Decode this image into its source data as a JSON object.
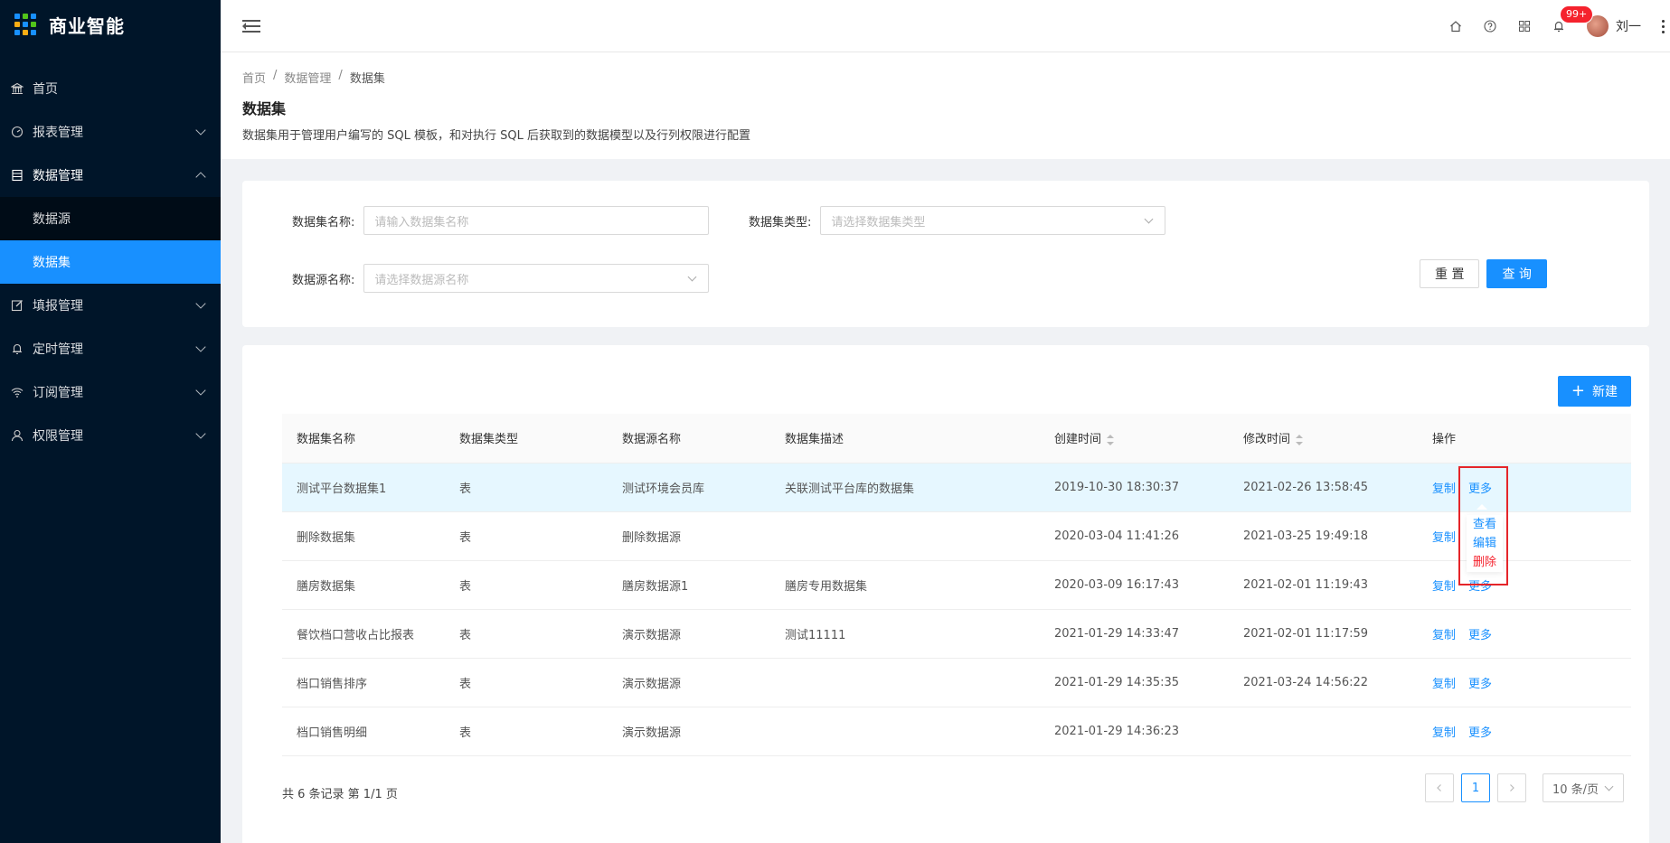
{
  "brand": {
    "title": "商业智能"
  },
  "sidebar": {
    "items": [
      {
        "label": "首页",
        "icon": "bank-icon"
      },
      {
        "label": "报表管理",
        "icon": "dashboard-icon"
      },
      {
        "label": "数据管理",
        "icon": "table-icon"
      },
      {
        "label": "填报管理",
        "icon": "edit-icon"
      },
      {
        "label": "定时管理",
        "icon": "bell-icon"
      },
      {
        "label": "订阅管理",
        "icon": "wifi-icon"
      },
      {
        "label": "权限管理",
        "icon": "user-icon"
      }
    ],
    "sub_items": [
      {
        "label": "数据源"
      },
      {
        "label": "数据集"
      }
    ]
  },
  "header": {
    "badge": "99+",
    "user_name": "刘一"
  },
  "breadcrumb": [
    "首页",
    "数据管理",
    "数据集"
  ],
  "page": {
    "title": "数据集",
    "description": "数据集用于管理用户编写的 SQL 模板，和对执行 SQL 后获取到的数据模型以及行列权限进行配置"
  },
  "filters": {
    "name_label": "数据集名称:",
    "name_placeholder": "请输入数据集名称",
    "type_label": "数据集类型:",
    "type_placeholder": "请选择数据集类型",
    "source_label": "数据源名称:",
    "source_placeholder": "请选择数据源名称",
    "reset_label": "重 置",
    "query_label": "查 询"
  },
  "toolbar": {
    "new_label": "新建"
  },
  "table": {
    "columns": [
      "数据集名称",
      "数据集类型",
      "数据源名称",
      "数据集描述",
      "创建时间",
      "修改时间",
      "操作"
    ],
    "rows": [
      {
        "name": "测试平台数据集1",
        "type": "表",
        "source": "测试环境会员库",
        "desc": "关联测试平台库的数据集",
        "created": "2019-10-30 18:30:37",
        "modified": "2021-02-26 13:58:45"
      },
      {
        "name": "删除数据集",
        "type": "表",
        "source": "删除数据源",
        "desc": "",
        "created": "2020-03-04 11:41:26",
        "modified": "2021-03-25 19:49:18"
      },
      {
        "name": "膳房数据集",
        "type": "表",
        "source": "膳房数据源1",
        "desc": "膳房专用数据集",
        "created": "2020-03-09 16:17:43",
        "modified": "2021-02-01 11:19:43"
      },
      {
        "name": "餐饮档口营收占比报表",
        "type": "表",
        "source": "演示数据源",
        "desc": "测试11111",
        "created": "2021-01-29 14:33:47",
        "modified": "2021-02-01 11:17:59"
      },
      {
        "name": "档口销售排序",
        "type": "表",
        "source": "演示数据源",
        "desc": "",
        "created": "2021-01-29 14:35:35",
        "modified": "2021-03-24 14:56:22"
      },
      {
        "name": "档口销售明细",
        "type": "表",
        "source": "演示数据源",
        "desc": "",
        "created": "2021-01-29 14:36:23",
        "modified": ""
      }
    ],
    "action_copy": "复制",
    "action_more": "更多"
  },
  "dropdown": {
    "view": "查看",
    "edit": "编辑",
    "delete": "删除"
  },
  "pagination": {
    "total_text": "共 6 条记录 第 1/1 页",
    "current_page": "1",
    "page_size": "10 条/页"
  },
  "colors": {
    "primary": "#1890ff",
    "sidebar_bg": "#001529",
    "danger": "#f5222d"
  }
}
